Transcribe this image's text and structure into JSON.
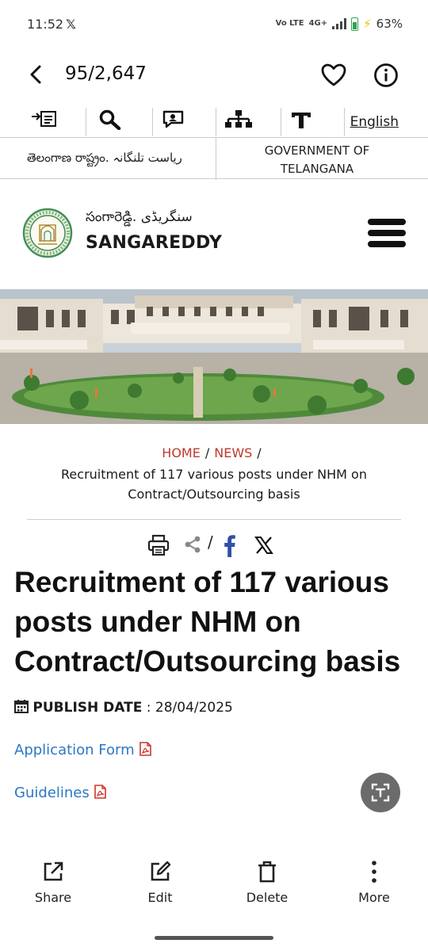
{
  "status_bar": {
    "time": "11:52",
    "x_glyph": "𝕏",
    "network": "4G+",
    "volte": "Vo LTE",
    "battery": "63%"
  },
  "viewer": {
    "counter": "95/2,647"
  },
  "site": {
    "toolbar": {
      "language_link": "English",
      "icons": [
        "skip-to-content-icon",
        "search-icon",
        "social-media-icon",
        "sitemap-icon",
        "text-size-icon"
      ]
    },
    "gov_bar": {
      "left": "తెలంగాణ రాష్ట్రం. ریاست تلنگانہ",
      "right": "GOVERNMENT OF TELANGANA"
    },
    "brand": {
      "local_name": "సంగారెడ్డి. سنگریڈی",
      "name": "SANGAREDDY"
    },
    "breadcrumb": {
      "home": "HOME",
      "news": "NEWS",
      "separator": "/",
      "current": "Recruitment of 117 various posts under NHM on Contract/Outsourcing basis"
    },
    "share": {
      "separator": "/"
    },
    "article": {
      "title": "Recruitment of 117 various posts under NHM on Contract/Outsourcing basis",
      "publish_label": "PUBLISH DATE",
      "publish_colon": ":",
      "publish_date": "28/04/2025",
      "links": [
        {
          "label": "Application Form"
        },
        {
          "label": "Guidelines"
        }
      ]
    }
  },
  "actions": {
    "share": "Share",
    "edit": "Edit",
    "delete": "Delete",
    "more": "More"
  },
  "colors": {
    "link": "#2b78c2",
    "breadcrumb_link": "#c0392b",
    "pdf_icon": "#d0342c",
    "battery": "#2da44e"
  }
}
